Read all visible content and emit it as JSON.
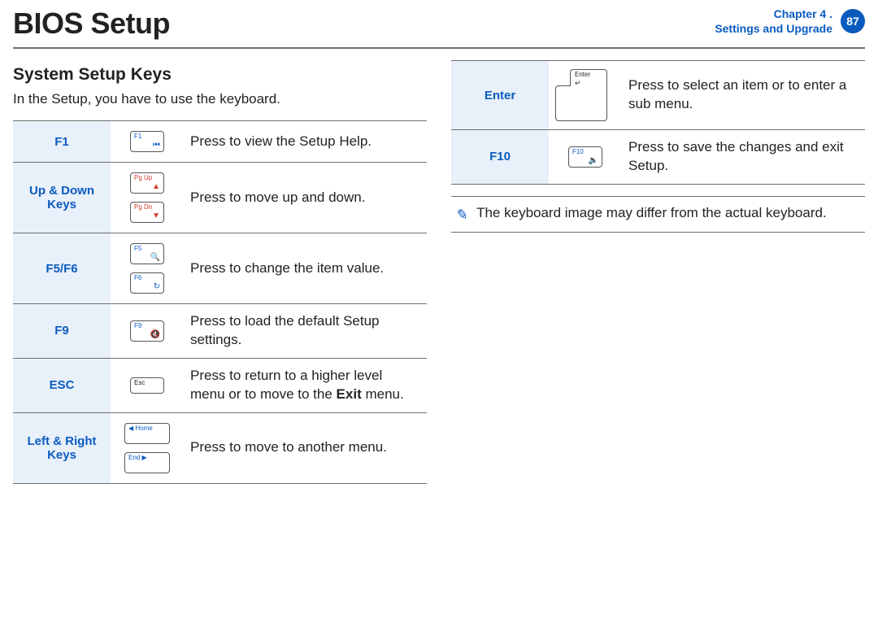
{
  "header": {
    "title": "BIOS Setup",
    "chapter_line1": "Chapter 4 .",
    "chapter_line2": "Settings and Upgrade",
    "page_number": "87"
  },
  "section": {
    "heading": "System Setup Keys",
    "intro": "In the Setup, you have to use the keyboard."
  },
  "left_keys": [
    {
      "name": "F1",
      "desc": "Press to view the Setup Help.",
      "caps": [
        {
          "label": "F1",
          "glyph": "⏮",
          "style": "blue"
        }
      ]
    },
    {
      "name": "Up & Down Keys",
      "desc": "Press to move up and down.",
      "caps": [
        {
          "label": "Pg Up",
          "glyph": "▲",
          "style": "red"
        },
        {
          "label": "Pg Dn",
          "glyph": "▼",
          "style": "red"
        }
      ]
    },
    {
      "name": "F5/F6",
      "desc": "Press to change the item value.",
      "caps": [
        {
          "label": "F5",
          "glyph": "🔍",
          "style": "blue"
        },
        {
          "label": "F6",
          "glyph": "↻",
          "style": "blue"
        }
      ]
    },
    {
      "name": "F9",
      "desc": "Press to load the default Setup settings.",
      "caps": [
        {
          "label": "F9",
          "glyph": "🔇",
          "style": "blue"
        }
      ]
    },
    {
      "name": "ESC",
      "desc_html": "Press to return to a higher level menu or to move to the <b>Exit</b> menu.",
      "caps": [
        {
          "label": "Esc",
          "glyph": "",
          "style": "",
          "cls": "esc"
        }
      ]
    },
    {
      "name": "Left & Right Keys",
      "desc": "Press to move to another menu.",
      "caps": [
        {
          "label": "◀ Home",
          "glyph": "",
          "style": "blue",
          "cls": "wide"
        },
        {
          "label": "End  ▶",
          "glyph": "",
          "style": "blue",
          "cls": "wide"
        }
      ]
    }
  ],
  "right_keys": [
    {
      "name": "Enter",
      "desc": "Press to select an item or to enter a sub menu.",
      "enter": {
        "label": "Enter",
        "arrow": "↵"
      }
    },
    {
      "name": "F10",
      "desc": "Press to save the changes and exit Setup.",
      "caps": [
        {
          "label": "F10",
          "glyph": "🔉",
          "style": "blue"
        }
      ]
    }
  ],
  "note": {
    "icon": "✎",
    "text": "The keyboard image may differ from the actual keyboard."
  }
}
